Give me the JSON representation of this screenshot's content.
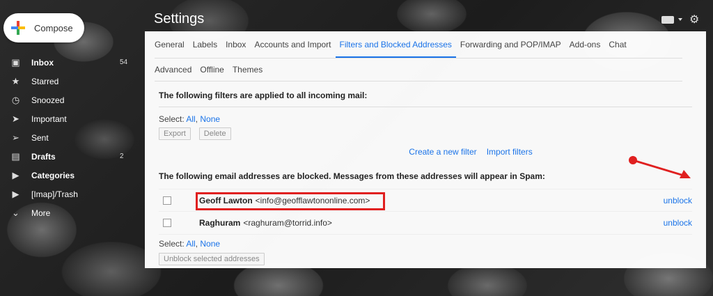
{
  "sidebar": {
    "compose_label": "Compose",
    "items": [
      {
        "label": "Inbox",
        "icon": "inbox-icon",
        "count": "54",
        "bold": true
      },
      {
        "label": "Starred",
        "icon": "star-icon",
        "count": "",
        "bold": false
      },
      {
        "label": "Snoozed",
        "icon": "clock-icon",
        "count": "",
        "bold": false
      },
      {
        "label": "Important",
        "icon": "important-icon",
        "count": "",
        "bold": false
      },
      {
        "label": "Sent",
        "icon": "send-icon",
        "count": "",
        "bold": false
      },
      {
        "label": "Drafts",
        "icon": "draft-icon",
        "count": "2",
        "bold": true
      },
      {
        "label": "Categories",
        "icon": "label-icon",
        "count": "",
        "bold": true
      },
      {
        "label": "[Imap]/Trash",
        "icon": "label-icon",
        "count": "",
        "bold": false
      },
      {
        "label": "More",
        "icon": "chevron-down-icon",
        "count": "",
        "bold": false
      }
    ]
  },
  "header": {
    "title": "Settings"
  },
  "tabs": {
    "row1": [
      "General",
      "Labels",
      "Inbox",
      "Accounts and Import",
      "Filters and Blocked Addresses",
      "Forwarding and POP/IMAP",
      "Add-ons",
      "Chat"
    ],
    "row2": [
      "Advanced",
      "Offline",
      "Themes"
    ],
    "active": "Filters and Blocked Addresses"
  },
  "filters": {
    "heading": "The following filters are applied to all incoming mail:",
    "select_label": "Select:",
    "select_all": "All",
    "select_none": "None",
    "export_label": "Export",
    "delete_label": "Delete",
    "create_filter": "Create a new filter",
    "import_filters": "Import filters"
  },
  "blocked": {
    "heading": "The following email addresses are blocked. Messages from these addresses will appear in Spam:",
    "rows": [
      {
        "name": "Geoff Lawton",
        "email": "<info@geofflawtononline.com>",
        "action": "unblock"
      },
      {
        "name": "Raghuram",
        "email": "<raghuram@torrid.info>",
        "action": "unblock"
      }
    ],
    "select_label": "Select:",
    "select_all": "All",
    "select_none": "None",
    "unblock_selected": "Unblock selected addresses"
  },
  "colors": {
    "accent": "#1a73e8",
    "annotation": "#e02020"
  }
}
